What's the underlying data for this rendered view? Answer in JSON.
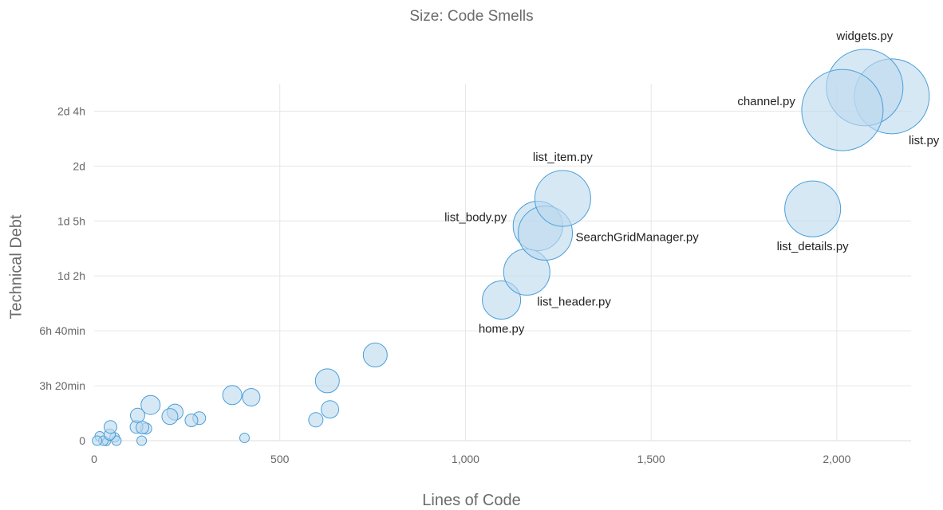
{
  "chart_data": {
    "type": "scatter",
    "size_label": "Size: Code Smells",
    "xlabel": "Lines of Code",
    "ylabel": "Technical Debt",
    "xlim": [
      0,
      2200
    ],
    "x_ticks": [
      {
        "value": 0,
        "label": "0"
      },
      {
        "value": 500,
        "label": "500"
      },
      {
        "value": 1000,
        "label": "1,000"
      },
      {
        "value": 1500,
        "label": "1,500"
      },
      {
        "value": 2000,
        "label": "2,000"
      }
    ],
    "y_ticks": [
      {
        "value": 0,
        "label": "0"
      },
      {
        "value": 1,
        "label": "3h 20min"
      },
      {
        "value": 2,
        "label": "6h 40min"
      },
      {
        "value": 3,
        "label": "1d 2h"
      },
      {
        "value": 4,
        "label": "1d 5h"
      },
      {
        "value": 5,
        "label": "2d"
      },
      {
        "value": 6,
        "label": "2d 4h"
      }
    ],
    "grid": true,
    "colors": {
      "fill": "#bcd9ef",
      "stroke": "#4a9fd8"
    },
    "points": [
      {
        "name": "widgets.py",
        "x": 2075,
        "y": 6.43,
        "size": 48
      },
      {
        "name": "list.py",
        "x": 2148,
        "y": 6.27,
        "size": 47
      },
      {
        "name": "channel.py",
        "x": 2015,
        "y": 6.02,
        "size": 51
      },
      {
        "name": "list_details.py",
        "x": 1935,
        "y": 4.22,
        "size": 35
      },
      {
        "name": "list_item.py",
        "x": 1262,
        "y": 4.41,
        "size": 35
      },
      {
        "name": "list_body.py",
        "x": 1195,
        "y": 3.91,
        "size": 31
      },
      {
        "name": "SearchGridManager.py",
        "x": 1215,
        "y": 3.78,
        "size": 34
      },
      {
        "name": "list_header.py",
        "x": 1165,
        "y": 3.07,
        "size": 29
      },
      {
        "name": "home.py",
        "x": 1097,
        "y": 2.56,
        "size": 24
      },
      {
        "name": "",
        "x": 757,
        "y": 1.56,
        "size": 15
      },
      {
        "name": "",
        "x": 628,
        "y": 1.09,
        "size": 15
      },
      {
        "name": "",
        "x": 635,
        "y": 0.57,
        "size": 11
      },
      {
        "name": "",
        "x": 597,
        "y": 0.38,
        "size": 9
      },
      {
        "name": "",
        "x": 372,
        "y": 0.83,
        "size": 12
      },
      {
        "name": "",
        "x": 423,
        "y": 0.79,
        "size": 11
      },
      {
        "name": "",
        "x": 405,
        "y": 0.05,
        "size": 6
      },
      {
        "name": "",
        "x": 152,
        "y": 0.65,
        "size": 12
      },
      {
        "name": "",
        "x": 218,
        "y": 0.52,
        "size": 10
      },
      {
        "name": "",
        "x": 204,
        "y": 0.44,
        "size": 10
      },
      {
        "name": "",
        "x": 283,
        "y": 0.41,
        "size": 8
      },
      {
        "name": "",
        "x": 262,
        "y": 0.37,
        "size": 8
      },
      {
        "name": "",
        "x": 117,
        "y": 0.46,
        "size": 9
      },
      {
        "name": "",
        "x": 114,
        "y": 0.25,
        "size": 8
      },
      {
        "name": "",
        "x": 130,
        "y": 0.24,
        "size": 8
      },
      {
        "name": "",
        "x": 140,
        "y": 0.22,
        "size": 7
      },
      {
        "name": "",
        "x": 128,
        "y": 0.0,
        "size": 6
      },
      {
        "name": "",
        "x": 44,
        "y": 0.25,
        "size": 8
      },
      {
        "name": "",
        "x": 42,
        "y": 0.11,
        "size": 7
      },
      {
        "name": "",
        "x": 55,
        "y": 0.06,
        "size": 6
      },
      {
        "name": "",
        "x": 60,
        "y": 0.0,
        "size": 6
      },
      {
        "name": "",
        "x": 15,
        "y": 0.08,
        "size": 6
      },
      {
        "name": "",
        "x": 25,
        "y": 0.0,
        "size": 6
      },
      {
        "name": "",
        "x": 8,
        "y": 0.0,
        "size": 6
      },
      {
        "name": "",
        "x": 33,
        "y": -0.02,
        "size": 5
      }
    ]
  }
}
